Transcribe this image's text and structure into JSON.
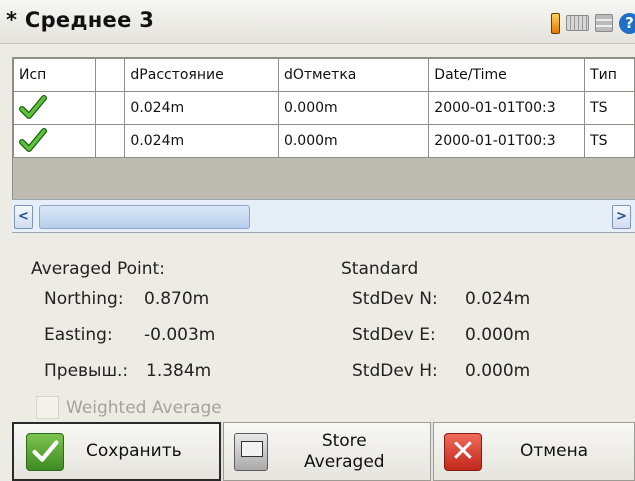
{
  "window": {
    "title": "* Среднее 3"
  },
  "table": {
    "headers": [
      "Исп",
      "",
      "dРасстояние",
      "dОтметка",
      "Date/Time",
      "Тип"
    ],
    "rows": [
      {
        "use_checked": true,
        "d_distance": "0.024m",
        "d_elevation": "0.000m",
        "datetime": "2000-01-01T00:3",
        "type": "TS"
      },
      {
        "use_checked": true,
        "d_distance": "0.024m",
        "d_elevation": "0.000m",
        "datetime": "2000-01-01T00:3",
        "type": "TS"
      }
    ]
  },
  "averaged": {
    "heading": "Averaged Point:",
    "northing_label": "Northing:",
    "northing_value": "0.870m",
    "easting_label": "Easting:",
    "easting_value": "-0.003m",
    "height_label": "Превыш.:",
    "height_value": "1.384m"
  },
  "standard": {
    "heading": "Standard",
    "stddev_n_label": "StdDev N:",
    "stddev_n_value": "0.024m",
    "stddev_e_label": "StdDev E:",
    "stddev_e_value": "0.000m",
    "stddev_h_label": "StdDev H:",
    "stddev_h_value": "0.000m"
  },
  "weighted_average": {
    "label": "Weighted Average",
    "checked": false,
    "enabled": false
  },
  "footer": {
    "save_label": "Сохранить",
    "store_averaged_line1": "Store",
    "store_averaged_line2": "Averaged",
    "cancel_label": "Отмена"
  },
  "colors": {
    "check_green": "#3f9b1f",
    "cancel_red": "#c1271b",
    "scroll_blue": "#b6cdec"
  }
}
